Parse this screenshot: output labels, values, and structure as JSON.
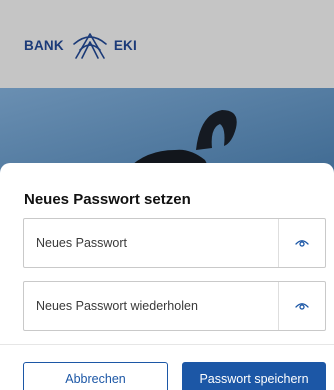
{
  "brand": {
    "left_text": "BANK",
    "right_text": "EKI",
    "color": "#1b3a78"
  },
  "dialog": {
    "title": "Neues Passwort setzen",
    "new_password": {
      "placeholder": "Neues Passwort",
      "icon": "eye-icon"
    },
    "repeat_password": {
      "placeholder": "Neues Passwort wiederholen",
      "icon": "eye-icon"
    },
    "cancel_label": "Abbrechen",
    "save_label": "Passwort speichern"
  },
  "colors": {
    "accent": "#1c57a6",
    "header_bg": "#c5c5c5",
    "photo_sky": "#5a7fa2"
  }
}
